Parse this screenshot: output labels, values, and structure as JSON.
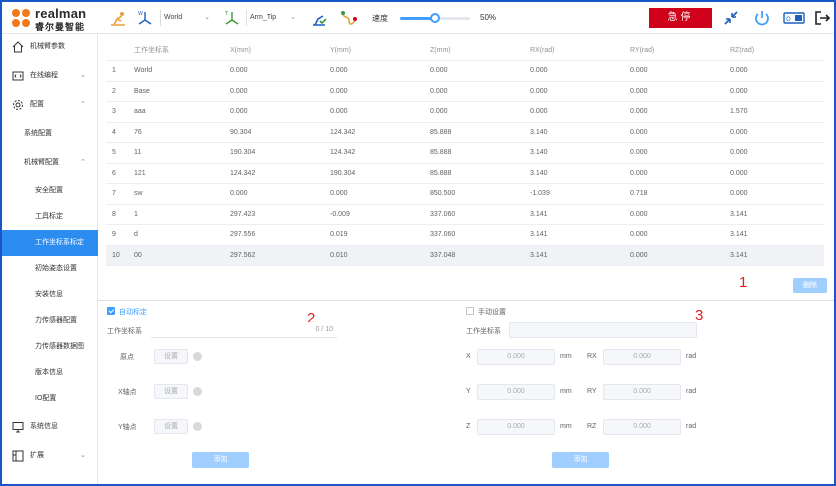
{
  "brand": {
    "name": "realman",
    "subtitle": "睿尔曼智能"
  },
  "toolbar": {
    "work_frame": "World",
    "tool_frame": "Arm_Tip",
    "speed_label": "速度",
    "speed_value": "50%",
    "speed_fraction": 0.5,
    "estop_label": "急停"
  },
  "sidebar": {
    "items": [
      {
        "label": "机械臂参数",
        "icon": "home-icon"
      },
      {
        "label": "在线编程",
        "icon": "code-icon"
      },
      {
        "label": "配置",
        "icon": "gear-icon"
      },
      {
        "label": "系统配置"
      },
      {
        "label": "机械臂配置"
      },
      {
        "label": "安全配置"
      },
      {
        "label": "工具标定"
      },
      {
        "label": "工作坐标系标定"
      },
      {
        "label": "初始姿态设置"
      },
      {
        "label": "安装信息"
      },
      {
        "label": "力传感器配置"
      },
      {
        "label": "力传感器数据图"
      },
      {
        "label": "版本信息"
      },
      {
        "label": "IO配置"
      },
      {
        "label": "系统信息",
        "icon": "monitor-icon"
      },
      {
        "label": "扩展",
        "icon": "extend-icon"
      }
    ]
  },
  "table": {
    "headers": [
      "",
      "工作坐标系",
      "X(mm)",
      "Y(mm)",
      "Z(mm)",
      "RX(rad)",
      "RY(rad)",
      "RZ(rad)"
    ],
    "rows": [
      [
        "1",
        "World",
        "0.000",
        "0.000",
        "0.000",
        "0.000",
        "0.000",
        "0.000"
      ],
      [
        "2",
        "Base",
        "0.000",
        "0.000",
        "0.000",
        "0.000",
        "0.000",
        "0.000"
      ],
      [
        "3",
        "aaa",
        "0.000",
        "0.000",
        "0.000",
        "0.000",
        "0.000",
        "1.570"
      ],
      [
        "4",
        "76",
        "90.304",
        "124.342",
        "85.888",
        "3.140",
        "0.000",
        "0.000"
      ],
      [
        "5",
        "11",
        "190.304",
        "124.342",
        "85.888",
        "3.140",
        "0.000",
        "0.000"
      ],
      [
        "6",
        "121",
        "124.342",
        "190.304",
        "85.888",
        "3.140",
        "0.000",
        "0.000"
      ],
      [
        "7",
        "sw",
        "0.000",
        "0.000",
        "850.500",
        "-1.039",
        "0.718",
        "0.000"
      ],
      [
        "8",
        "1",
        "297.423",
        "-0.009",
        "337.060",
        "3.141",
        "0.000",
        "3.141"
      ],
      [
        "9",
        "d",
        "297.556",
        "0.019",
        "337.060",
        "3.141",
        "0.000",
        "3.141"
      ],
      [
        "10",
        "00",
        "297.562",
        "0.010",
        "337.048",
        "3.141",
        "0.000",
        "3.141"
      ]
    ]
  },
  "annotations": [
    "1",
    "2",
    "3"
  ],
  "delete_label": "删除",
  "auto": {
    "checkbox_label": "自动标定",
    "name_label": "工作坐标系",
    "counter": "0 / 10",
    "origin_label": "原点",
    "xaxis_label": "X轴点",
    "yaxis_label": "Y轴点",
    "set_label": "设置",
    "add_label": "添加"
  },
  "manual": {
    "checkbox_label": "手动设置",
    "name_label": "工作坐标系",
    "fields": [
      {
        "label": "X",
        "value": "0.000",
        "unit": "mm"
      },
      {
        "label": "Y",
        "value": "0.000",
        "unit": "mm"
      },
      {
        "label": "Z",
        "value": "0.000",
        "unit": "mm"
      },
      {
        "label": "RX",
        "value": "0.000",
        "unit": "rad"
      },
      {
        "label": "RY",
        "value": "0.000",
        "unit": "rad"
      },
      {
        "label": "RZ",
        "value": "0.000",
        "unit": "rad"
      }
    ],
    "add_label": "添加"
  },
  "colors": {
    "accent": "#409eff",
    "estop": "#d0021b",
    "active": "#2d8cf0",
    "brand_orange": "#f07a1a"
  }
}
